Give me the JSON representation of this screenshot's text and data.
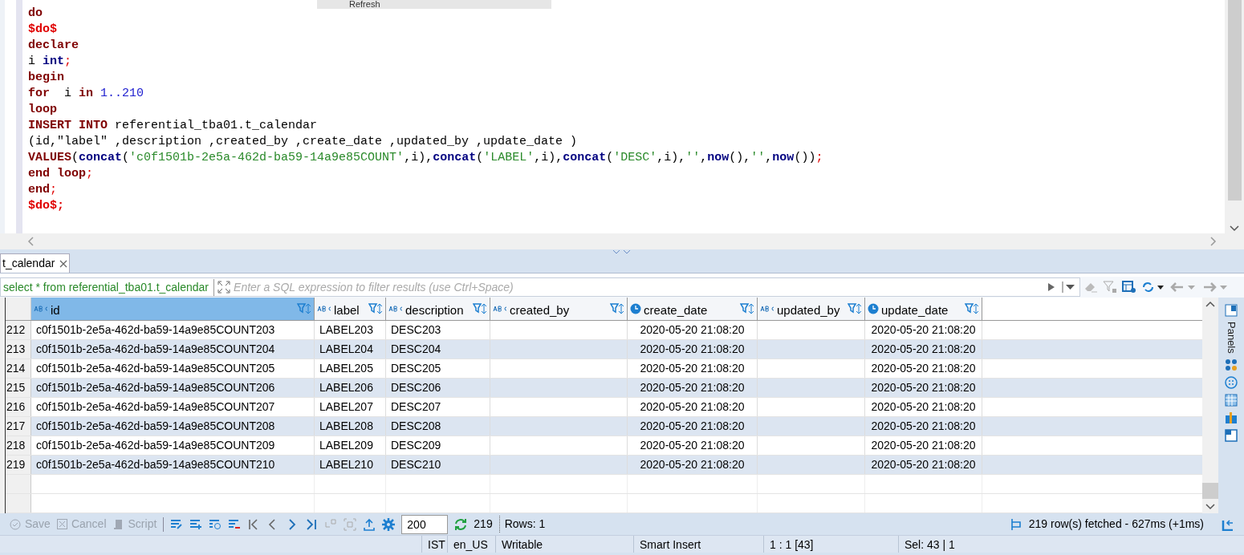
{
  "popup_menu": {
    "item": "Refresh"
  },
  "editor": {
    "lines": [
      [
        {
          "kind": "keyword",
          "text": "do"
        }
      ],
      [
        {
          "kind": "dollar",
          "text": "$do$"
        }
      ],
      [
        {
          "kind": "keyword",
          "text": "declare"
        }
      ],
      [
        {
          "kind": "plain",
          "text": "i "
        },
        {
          "kind": "type",
          "text": "int"
        },
        {
          "kind": "punct",
          "text": ";"
        }
      ],
      [
        {
          "kind": "keyword",
          "text": "begin"
        }
      ],
      [
        {
          "kind": "keyword",
          "text": "for"
        },
        {
          "kind": "plain",
          "text": "  i "
        },
        {
          "kind": "keyword",
          "text": "in"
        },
        {
          "kind": "number",
          "text": " 1..210"
        }
      ],
      [
        {
          "kind": "keyword",
          "text": "loop"
        }
      ],
      [
        {
          "kind": "keyword",
          "text": "INSERT INTO"
        },
        {
          "kind": "plain",
          "text": " referential_tba01.t_calendar"
        }
      ],
      [
        {
          "kind": "plain",
          "text": "(id,\"label\" ,description ,created_by ,create_date ,updated_by ,update_date )"
        }
      ],
      [
        {
          "kind": "keyword",
          "text": "VALUES"
        },
        {
          "kind": "plain",
          "text": "("
        },
        {
          "kind": "func",
          "text": "concat"
        },
        {
          "kind": "plain",
          "text": "("
        },
        {
          "kind": "string",
          "text": "'c0f1501b-2e5a-462d-ba59-14a9e85COUNT'"
        },
        {
          "kind": "plain",
          "text": ",i),"
        },
        {
          "kind": "func",
          "text": "concat"
        },
        {
          "kind": "plain",
          "text": "("
        },
        {
          "kind": "string",
          "text": "'LABEL'"
        },
        {
          "kind": "plain",
          "text": ",i),"
        },
        {
          "kind": "func",
          "text": "concat"
        },
        {
          "kind": "plain",
          "text": "("
        },
        {
          "kind": "string",
          "text": "'DESC'"
        },
        {
          "kind": "plain",
          "text": ",i),"
        },
        {
          "kind": "string",
          "text": "''"
        },
        {
          "kind": "plain",
          "text": ","
        },
        {
          "kind": "func",
          "text": "now"
        },
        {
          "kind": "plain",
          "text": "(),"
        },
        {
          "kind": "string",
          "text": "''"
        },
        {
          "kind": "plain",
          "text": ","
        },
        {
          "kind": "func",
          "text": "now"
        },
        {
          "kind": "plain",
          "text": "())"
        },
        {
          "kind": "punct",
          "text": ";"
        }
      ],
      [
        {
          "kind": "keyword",
          "text": "end loop"
        },
        {
          "kind": "punct",
          "text": ";"
        }
      ],
      [
        {
          "kind": "keyword",
          "text": "end"
        },
        {
          "kind": "punct",
          "text": ";"
        }
      ],
      [
        {
          "kind": "dollar",
          "text": "$do$;"
        }
      ]
    ]
  },
  "results_tab": {
    "title": "t_calendar",
    "selected": true
  },
  "filter": {
    "query": "select * from referential_tba01.t_calendar",
    "placeholder": "Enter a SQL expression to filter results (use Ctrl+Space)"
  },
  "table": {
    "columns": [
      {
        "name": "id",
        "kind": "text",
        "selected": true
      },
      {
        "name": "label",
        "kind": "text",
        "selected": false
      },
      {
        "name": "description",
        "kind": "text",
        "selected": false
      },
      {
        "name": "created_by",
        "kind": "text",
        "selected": false
      },
      {
        "name": "create_date",
        "kind": "date",
        "selected": false
      },
      {
        "name": "updated_by",
        "kind": "text",
        "selected": false
      },
      {
        "name": "update_date",
        "kind": "date",
        "selected": false
      }
    ],
    "rows": [
      {
        "num": "212",
        "cells": [
          "c0f1501b-2e5a-462d-ba59-14a9e85COUNT203",
          "LABEL203",
          "DESC203",
          null,
          "2020-05-20 21:08:20",
          null,
          "2020-05-20 21:08:20"
        ]
      },
      {
        "num": "213",
        "cells": [
          "c0f1501b-2e5a-462d-ba59-14a9e85COUNT204",
          "LABEL204",
          "DESC204",
          null,
          "2020-05-20 21:08:20",
          null,
          "2020-05-20 21:08:20"
        ]
      },
      {
        "num": "214",
        "cells": [
          "c0f1501b-2e5a-462d-ba59-14a9e85COUNT205",
          "LABEL205",
          "DESC205",
          null,
          "2020-05-20 21:08:20",
          null,
          "2020-05-20 21:08:20"
        ]
      },
      {
        "num": "215",
        "cells": [
          "c0f1501b-2e5a-462d-ba59-14a9e85COUNT206",
          "LABEL206",
          "DESC206",
          null,
          "2020-05-20 21:08:20",
          null,
          "2020-05-20 21:08:20"
        ]
      },
      {
        "num": "216",
        "cells": [
          "c0f1501b-2e5a-462d-ba59-14a9e85COUNT207",
          "LABEL207",
          "DESC207",
          null,
          "2020-05-20 21:08:20",
          null,
          "2020-05-20 21:08:20"
        ]
      },
      {
        "num": "217",
        "cells": [
          "c0f1501b-2e5a-462d-ba59-14a9e85COUNT208",
          "LABEL208",
          "DESC208",
          null,
          "2020-05-20 21:08:20",
          null,
          "2020-05-20 21:08:20"
        ]
      },
      {
        "num": "218",
        "cells": [
          "c0f1501b-2e5a-462d-ba59-14a9e85COUNT209",
          "LABEL209",
          "DESC209",
          null,
          "2020-05-20 21:08:20",
          null,
          "2020-05-20 21:08:20"
        ]
      },
      {
        "num": "219",
        "cells": [
          "c0f1501b-2e5a-462d-ba59-14a9e85COUNT210",
          "LABEL210",
          "DESC210",
          null,
          "2020-05-20 21:08:20",
          null,
          "2020-05-20 21:08:20"
        ]
      }
    ]
  },
  "side_panel": {
    "label": "Panels"
  },
  "toolbar": {
    "actions": [
      {
        "label": "Save",
        "disabled": true
      },
      {
        "label": "Cancel",
        "disabled": true
      },
      {
        "label": "Script",
        "disabled": true
      }
    ],
    "fetch_size": "200",
    "refresh_count": "219",
    "rows": "Rows: 1",
    "fetch_status": "219 row(s) fetched - 627ms (+1ms)"
  },
  "status_bar": [
    "IST",
    "en_US",
    "Writable",
    "Smart Insert",
    "1 : 1 [43]",
    "Sel: 43 | 1"
  ]
}
